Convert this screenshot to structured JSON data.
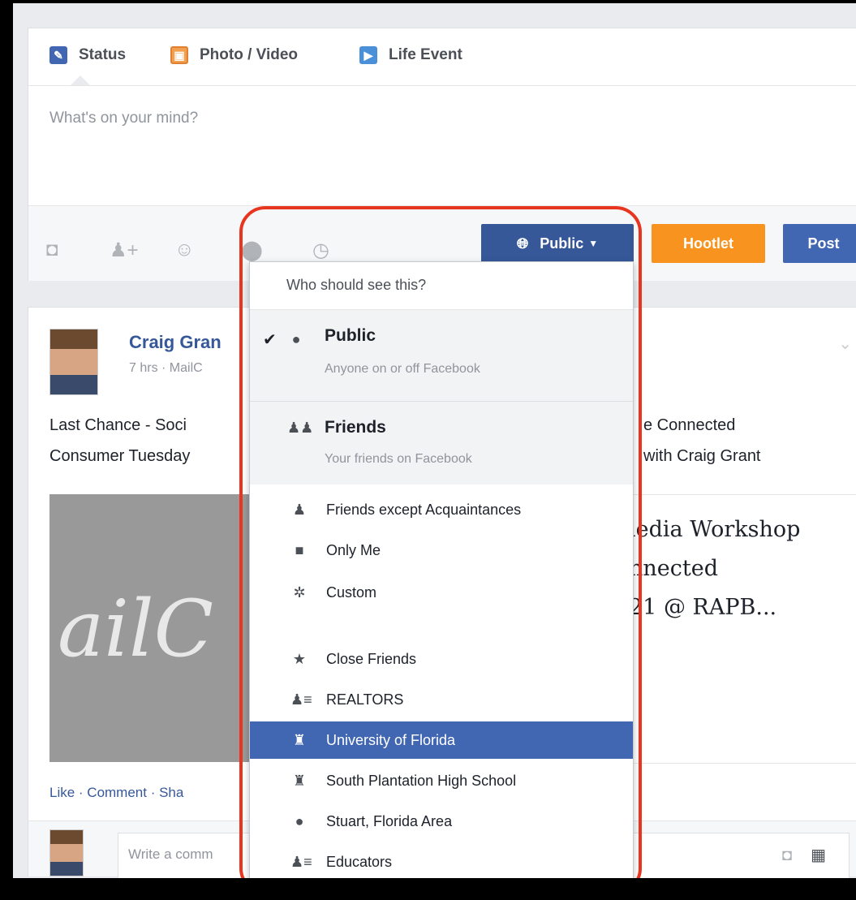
{
  "composer": {
    "tabs": [
      {
        "label": "Status",
        "icon": "pencil-icon"
      },
      {
        "label": "Photo / Video",
        "icon": "photo-icon"
      },
      {
        "label": "Life Event",
        "icon": "flag-icon"
      }
    ],
    "placeholder": "What's on your mind?",
    "tools": [
      "camera-icon",
      "tag-friends-icon",
      "feeling-icon",
      "location-icon",
      "clock-icon"
    ],
    "audience_button": "Public",
    "hootlet_button": "Hootlet",
    "post_button": "Post",
    "colors": {
      "facebook_blue": "#365899",
      "hootlet_orange": "#f7931e",
      "highlight_red": "#e8351f"
    }
  },
  "post": {
    "author": "Craig Gran",
    "meta": "7 hrs · MailC",
    "text_left": [
      "Last Chance - Soci",
      "Consumer Tuesday"
    ],
    "text_right": [
      "e Connected",
      "with Craig Grant"
    ],
    "link_image_text": "ailC",
    "link_title": [
      "ledia Workshop",
      "nnected",
      "21 @ RAPB..."
    ],
    "actions": "Like · Comment · Sha",
    "comment_placeholder": "Write a comm"
  },
  "dropdown": {
    "header": "Who should see this?",
    "public": {
      "title": "Public",
      "subtitle": "Anyone on or off Facebook"
    },
    "friends": {
      "title": "Friends",
      "subtitle": "Your friends on Facebook"
    },
    "items": [
      {
        "label": "Friends except Acquaintances",
        "icon": "friends-icon"
      },
      {
        "label": "Only Me",
        "icon": "lock-icon"
      },
      {
        "label": "Custom",
        "icon": "gear-icon"
      },
      {
        "label": "Close Friends",
        "icon": "star-icon"
      },
      {
        "label": "REALTORS",
        "icon": "list-icon"
      },
      {
        "label": "University of Florida",
        "icon": "school-icon",
        "selected": true
      },
      {
        "label": "South Plantation High School",
        "icon": "school-icon"
      },
      {
        "label": "Stuart, Florida Area",
        "icon": "location-icon"
      },
      {
        "label": "Educators",
        "icon": "list-icon"
      }
    ]
  }
}
